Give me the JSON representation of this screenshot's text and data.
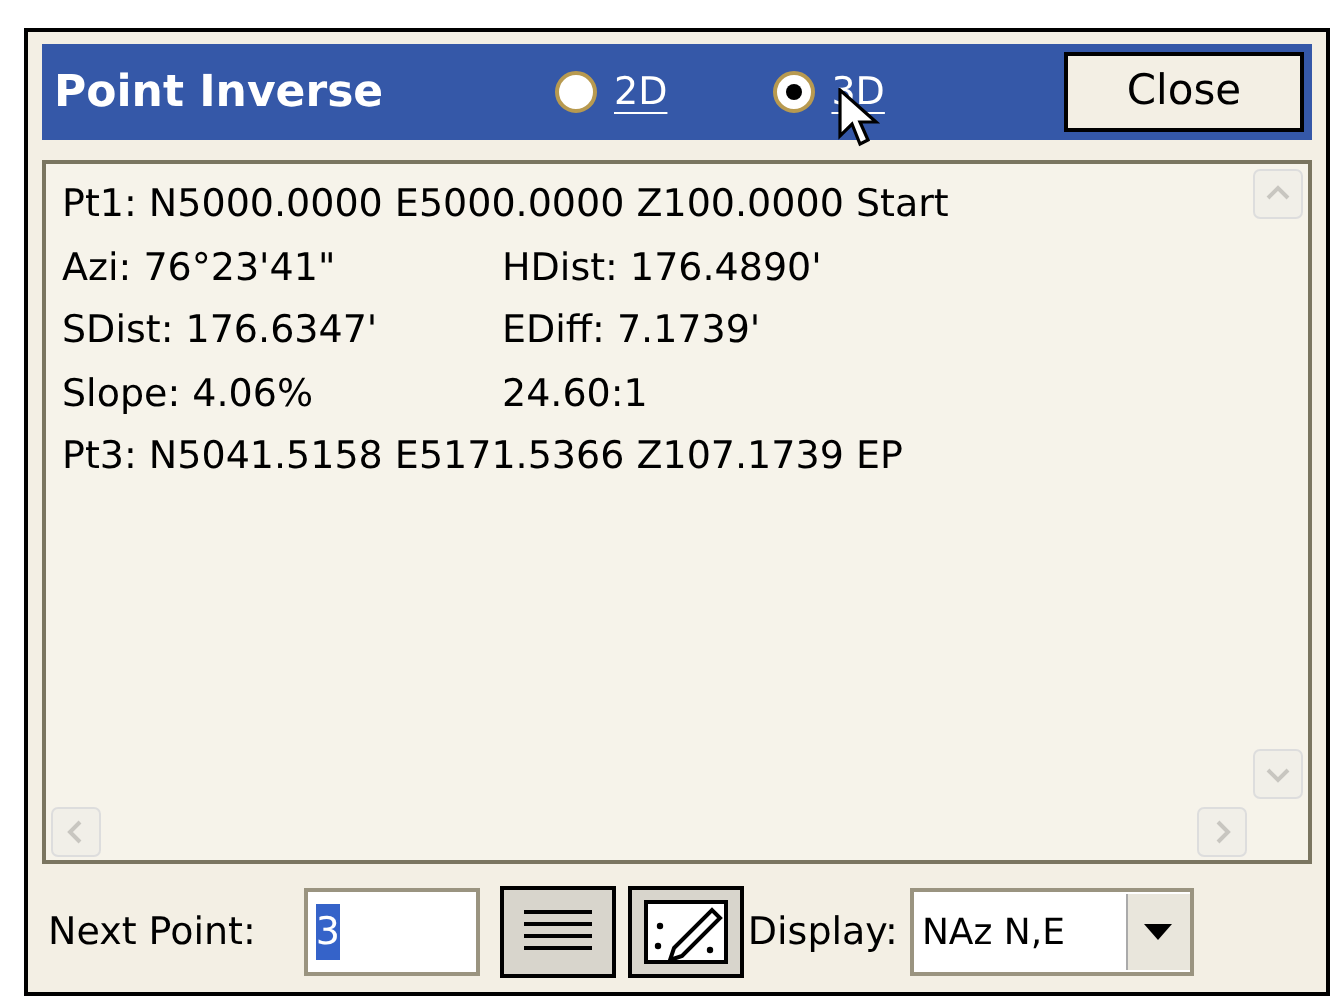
{
  "window": {
    "title": "Point Inverse",
    "close_button": "Close"
  },
  "mode_options": [
    {
      "label": "2D",
      "selected": false
    },
    {
      "label": "3D",
      "selected": true
    }
  ],
  "results": [
    {
      "kind": "full",
      "text": "Pt1: N5000.0000 E5000.0000 Z100.0000 Start"
    },
    {
      "kind": "pair",
      "left": "Azi: 76°23'41\"",
      "right": "HDist: 176.4890'"
    },
    {
      "kind": "pair",
      "left": "SDist: 176.6347'",
      "right": "EDiff: 7.1739'"
    },
    {
      "kind": "pair",
      "left": "Slope: 4.06%",
      "right": "24.60:1"
    },
    {
      "kind": "full",
      "text": "Pt3: N5041.5158 E5171.5366 Z107.1739 EP"
    }
  ],
  "bottom": {
    "next_point_label": "Next Point:",
    "next_point_value": "3",
    "display_label": "Display:",
    "display_value": "NAz N,E"
  }
}
